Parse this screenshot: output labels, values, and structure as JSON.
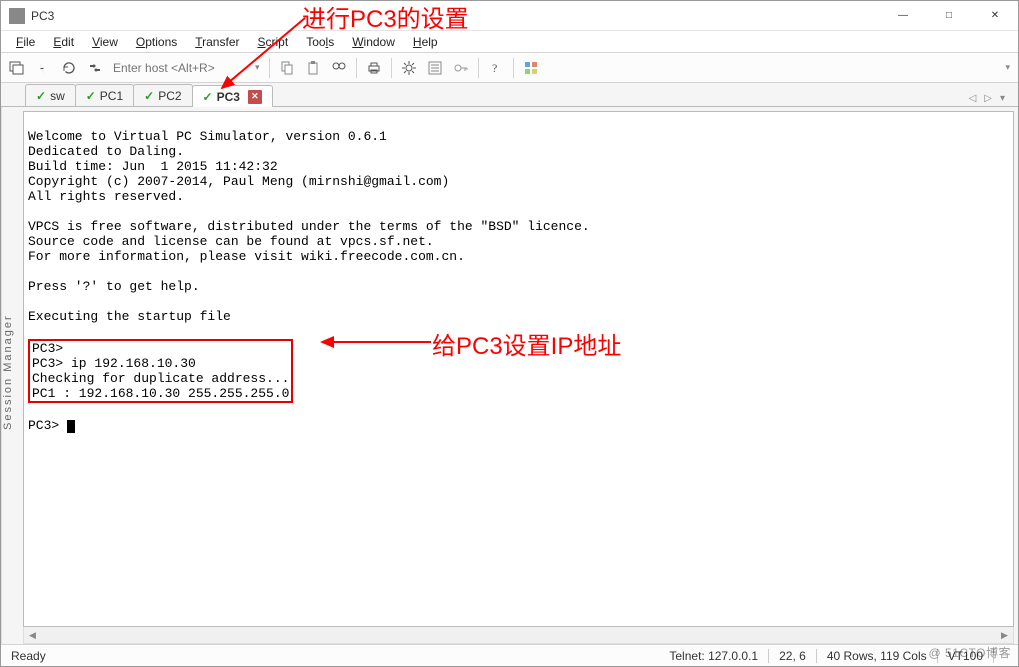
{
  "window": {
    "title": "PC3"
  },
  "menubar": {
    "items": [
      {
        "label": "File",
        "ul": "F"
      },
      {
        "label": "Edit",
        "ul": "E"
      },
      {
        "label": "View",
        "ul": "V"
      },
      {
        "label": "Options",
        "ul": "O"
      },
      {
        "label": "Transfer",
        "ul": "T"
      },
      {
        "label": "Script",
        "ul": "S"
      },
      {
        "label": "Tools",
        "ul": "T"
      },
      {
        "label": "Window",
        "ul": "W"
      },
      {
        "label": "Help",
        "ul": "H"
      }
    ]
  },
  "toolbar": {
    "host_placeholder": "Enter host <Alt+R>"
  },
  "tabs": {
    "items": [
      {
        "label": "sw",
        "active": false
      },
      {
        "label": "PC1",
        "active": false
      },
      {
        "label": "PC2",
        "active": false
      },
      {
        "label": "PC3",
        "active": true
      }
    ]
  },
  "sidebar": {
    "label": "Session Manager"
  },
  "terminal": {
    "pre": "\nWelcome to Virtual PC Simulator, version 0.6.1\nDedicated to Daling.\nBuild time: Jun  1 2015 11:42:32\nCopyright (c) 2007-2014, Paul Meng (mirnshi@gmail.com)\nAll rights reserved.\n\nVPCS is free software, distributed under the terms of the \"BSD\" licence.\nSource code and license can be found at vpcs.sf.net.\nFor more information, please visit wiki.freecode.com.cn.\n\nPress '?' to get help.\n\nExecuting the startup file\n",
    "boxed": "PC3>\nPC3> ip 192.168.10.30\nChecking for duplicate address...\nPC1 : 192.168.10.30 255.255.255.0",
    "post_prompt": "PC3> "
  },
  "status": {
    "ready": "Ready",
    "conn": "Telnet: 127.0.0.1",
    "pos": "22,  6",
    "size": "40 Rows, 119 Cols",
    "emul": "VT100"
  },
  "annotations": {
    "top": "进行PC3的设置",
    "mid": "给PC3设置IP地址"
  },
  "watermark": "@ 51CTO博客"
}
